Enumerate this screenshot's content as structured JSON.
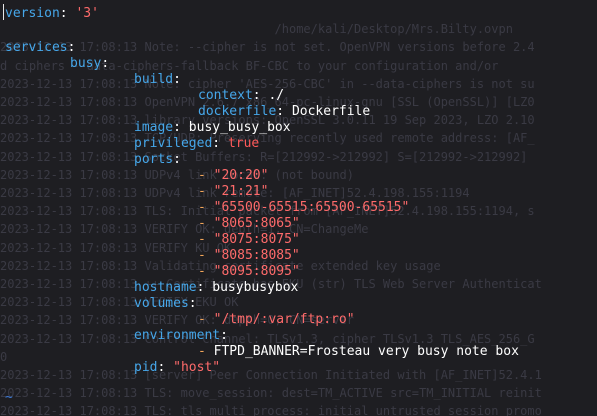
{
  "background_log": [
    "",
    "                                      /home/kali/Desktop/Mrs.Bilty.ovpn",
    "2023-12-13 17:08:13 Note: --cipher is not set. OpenVPN versions before 2.4",
    "d ciphers --data-ciphers-fallback BF-CBC to your configuration and/or",
    "2023-12-13 17:08:13 Note: cipher 'AES-256-CBC' in --data-ciphers is not su",
    "2023-12-13 17:08:13 OpenVPN 2.6.7 x86_64-pc-linux-gnu [SSL (OpenSSL)] [LZ0",
    "2023-12-13 17:08:13 library versions: OpenSSL 3.0.11 19 Sep 2023, LZO 2.10",
    "2023-12-13 17:08:13 TCP/UDP: Preserving recently used remote address: [AF_",
    "2023-12-13 17:08:13 Socket Buffers: R=[212992->212992] S=[212992->212992]",
    "2023-12-13 17:08:13 UDPv4 link local: (not bound)",
    "2023-12-13 17:08:13 UDPv4 link remote: [AF_INET]52.4.198.155:1194",
    "2023-12-13 17:08:13 TLS: Initial packet from [AF_INET]52.4.198.155:1194, s",
    "2023-12-13 17:08:13 VERIFY OK: depth=1, CN=ChangeMe",
    "2023-12-13 17:08:13 VERIFY KU OK",
    "2023-12-13 17:08:13 Validating certificate extended key usage",
    "2023-12-13 17:08:13 ++ Certificate has EKU (str) TLS Web Server Authenticat",
    "2023-12-13 17:08:13 VERIFY EKU OK",
    "2023-12-13 17:08:13 VERIFY OK: depth=0, CN=server",
    "2023-12-13 17:08:13 Control Channel: TLSv1.3, cipher TLSv1.3 TLS_AES_256_G",
    "0",
    "2023-12-13 17:08:13 [server] Peer Connection Initiated with [AF_INET]52.4.1",
    "2023-12-13 17:08:13 TLS: move_session: dest=TM_ACTIVE src=TM_INITIAL reinit",
    "2023-12-13 17:08:13 TLS: tls_multi_process: initial untrusted session promo",
    "2023-12-13 17:08:14 SENT CONTROL [server]: 'PUSH_REQUEST' (status=1)",
    "2023-12-13 17:08:14 PUSH: Received control message: 'PUSH_REPLY,route-gate"
  ],
  "compose": {
    "version_key": "version",
    "version_value": "'3'",
    "services_key": "services",
    "service_name": "busy",
    "build_key": "build",
    "context_key": "context",
    "context_value": "./",
    "dockerfile_key": "dockerfile",
    "dockerfile_value": "Dockerfile",
    "image_key": "image",
    "image_value": "busy_busy_box",
    "privileged_key": "privileged",
    "privileged_value": "true",
    "ports_key": "ports",
    "ports": [
      "\"20:20\"",
      "\"21:21\"",
      "\"65500-65515:65500-65515\"",
      "\"8065:8065\"",
      "\"8075:8075\"",
      "\"8085:8085\"",
      "\"8095:8095\""
    ],
    "hostname_key": "hostname",
    "hostname_value": "busybusybox",
    "volumes_key": "volumes",
    "volume_value": "\"/tmp/:var/ftp:ro\"",
    "environment_key": "environment",
    "environment_value": "FTPD_BANNER=Frosteau very busy note box",
    "pid_key": "pid",
    "pid_value": "\"host\"",
    "tilde": "~"
  },
  "colors": {
    "background": "#1e1e22",
    "key": "#46a7ea",
    "string": "#ff6b6b",
    "list_dash": "#f2a65a",
    "text": "#ffffff",
    "tilde": "#3d7bd9",
    "background_log_text": "#3a3a44"
  }
}
